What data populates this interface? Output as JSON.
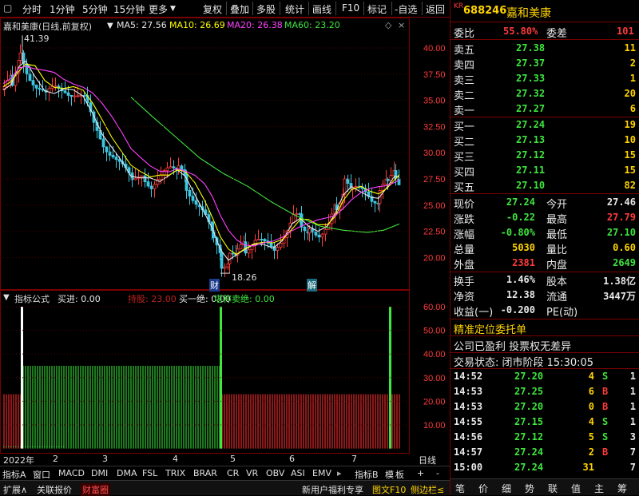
{
  "toolbar": {
    "items": [
      "分时",
      "1分钟",
      "5分钟",
      "15分钟",
      "更多",
      "复权",
      "叠加",
      "多股",
      "统计",
      "画线",
      "F10",
      "标记",
      "-自选",
      "返回"
    ]
  },
  "chart": {
    "stock_title": "嘉和美康(日线,前复权)",
    "ma5": "MA5: 27.56",
    "ma10": "MA10: 26.69",
    "ma20": "MA20: 26.38",
    "ma60": "MA60: 23.20",
    "high_label": "41.39",
    "low_label": "18.26",
    "marker_cai": "财",
    "marker_jie": "解",
    "price_ticks": [
      "40.00",
      "37.50",
      "35.00",
      "32.50",
      "30.00",
      "27.50",
      "25.00",
      "22.50",
      "20.00"
    ]
  },
  "indicator": {
    "title": "指标公式",
    "buy_in": "买进: 0.00",
    "hold": "持股: 23.00",
    "buy_one": "买一绝: 0.00",
    "sell": "堪称卖绝: 0.00",
    "ticks": [
      "60.00",
      "50.00",
      "40.00",
      "30.00",
      "20.00",
      "10.00"
    ]
  },
  "x_axis": {
    "labels": [
      "2022年",
      "2",
      "3",
      "4",
      "5",
      "6",
      "7"
    ],
    "period": "日线"
  },
  "indicator_tabs": [
    "指标A",
    "窗口",
    "MACD",
    "DMI",
    "DMA",
    "FSL",
    "TRIX",
    "BRAR",
    "CR",
    "VR",
    "OBV",
    "ASI",
    "EMV"
  ],
  "indicator_tabs_right": [
    "指标B",
    "模",
    "板",
    "+",
    "-"
  ],
  "bottom_bar": {
    "left": [
      "扩展∧",
      "关联报价",
      "财富圈"
    ],
    "right": [
      "新用户福利专享",
      "图文F10",
      "侧边栏≤"
    ]
  },
  "quote": {
    "code_prefix": "KR",
    "code": "688246",
    "name": "嘉和美康",
    "weibi_label": "委比",
    "weibi": "55.80%",
    "weicha_label": "委差",
    "weicha": "101",
    "asks": [
      {
        "label": "卖五",
        "price": "27.38",
        "vol": "11"
      },
      {
        "label": "卖四",
        "price": "27.37",
        "vol": "2"
      },
      {
        "label": "卖三",
        "price": "27.33",
        "vol": "1"
      },
      {
        "label": "卖二",
        "price": "27.32",
        "vol": "20"
      },
      {
        "label": "卖一",
        "price": "27.27",
        "vol": "6"
      }
    ],
    "bids": [
      {
        "label": "买一",
        "price": "27.24",
        "vol": "19"
      },
      {
        "label": "买二",
        "price": "27.13",
        "vol": "10"
      },
      {
        "label": "买三",
        "price": "27.12",
        "vol": "15"
      },
      {
        "label": "买四",
        "price": "27.11",
        "vol": "15"
      },
      {
        "label": "买五",
        "price": "27.10",
        "vol": "82"
      }
    ],
    "stats": [
      {
        "l1": "现价",
        "v1": "27.24",
        "c1": "gr",
        "l2": "今开",
        "v2": "27.46",
        "c2": "wh"
      },
      {
        "l1": "涨跌",
        "v1": "-0.22",
        "c1": "gr",
        "l2": "最高",
        "v2": "27.79",
        "c2": "rd"
      },
      {
        "l1": "涨幅",
        "v1": "-0.80%",
        "c1": "gr",
        "l2": "最低",
        "v2": "27.10",
        "c2": "gr"
      },
      {
        "l1": "总量",
        "v1": "5030",
        "c1": "yl",
        "l2": "量比",
        "v2": "0.60",
        "c2": "yl"
      },
      {
        "l1": "外盘",
        "v1": "2381",
        "c1": "rd",
        "l2": "内盘",
        "v2": "2649",
        "c2": "gr"
      }
    ],
    "stats2": [
      {
        "l1": "换手",
        "v1": "1.46%",
        "l2": "股本",
        "v2": "1.38亿"
      },
      {
        "l1": "净资",
        "v1": "12.38",
        "l2": "流通",
        "v2": "3447万"
      },
      {
        "l1": "收益(一)",
        "v1": "-0.200",
        "l2": "PE(动)",
        "v2": ""
      }
    ],
    "precise_order": "精准定位委托单",
    "company_info": "公司已盈利 投票权无差异",
    "trade_status": "交易状态: 闭市阶段 15:30:05",
    "ticks": [
      {
        "time": "14:52",
        "price": "27.20",
        "vol": "4",
        "side": "S",
        "n": "1"
      },
      {
        "time": "14:53",
        "price": "27.25",
        "vol": "6",
        "side": "B",
        "n": "1"
      },
      {
        "time": "14:53",
        "price": "27.20",
        "vol": "0",
        "side": "B",
        "n": "1"
      },
      {
        "time": "14:55",
        "price": "27.15",
        "vol": "4",
        "side": "S",
        "n": "1"
      },
      {
        "time": "14:56",
        "price": "27.12",
        "vol": "5",
        "side": "S",
        "n": "3"
      },
      {
        "time": "14:57",
        "price": "27.24",
        "vol": "2",
        "side": "B",
        "n": "7"
      },
      {
        "time": "15:00",
        "price": "27.24",
        "vol": "31",
        "side": "",
        "n": "7"
      }
    ]
  },
  "right_tabs": [
    "笔",
    "价",
    "细",
    "势",
    "联",
    "值",
    "主",
    "筹"
  ]
}
